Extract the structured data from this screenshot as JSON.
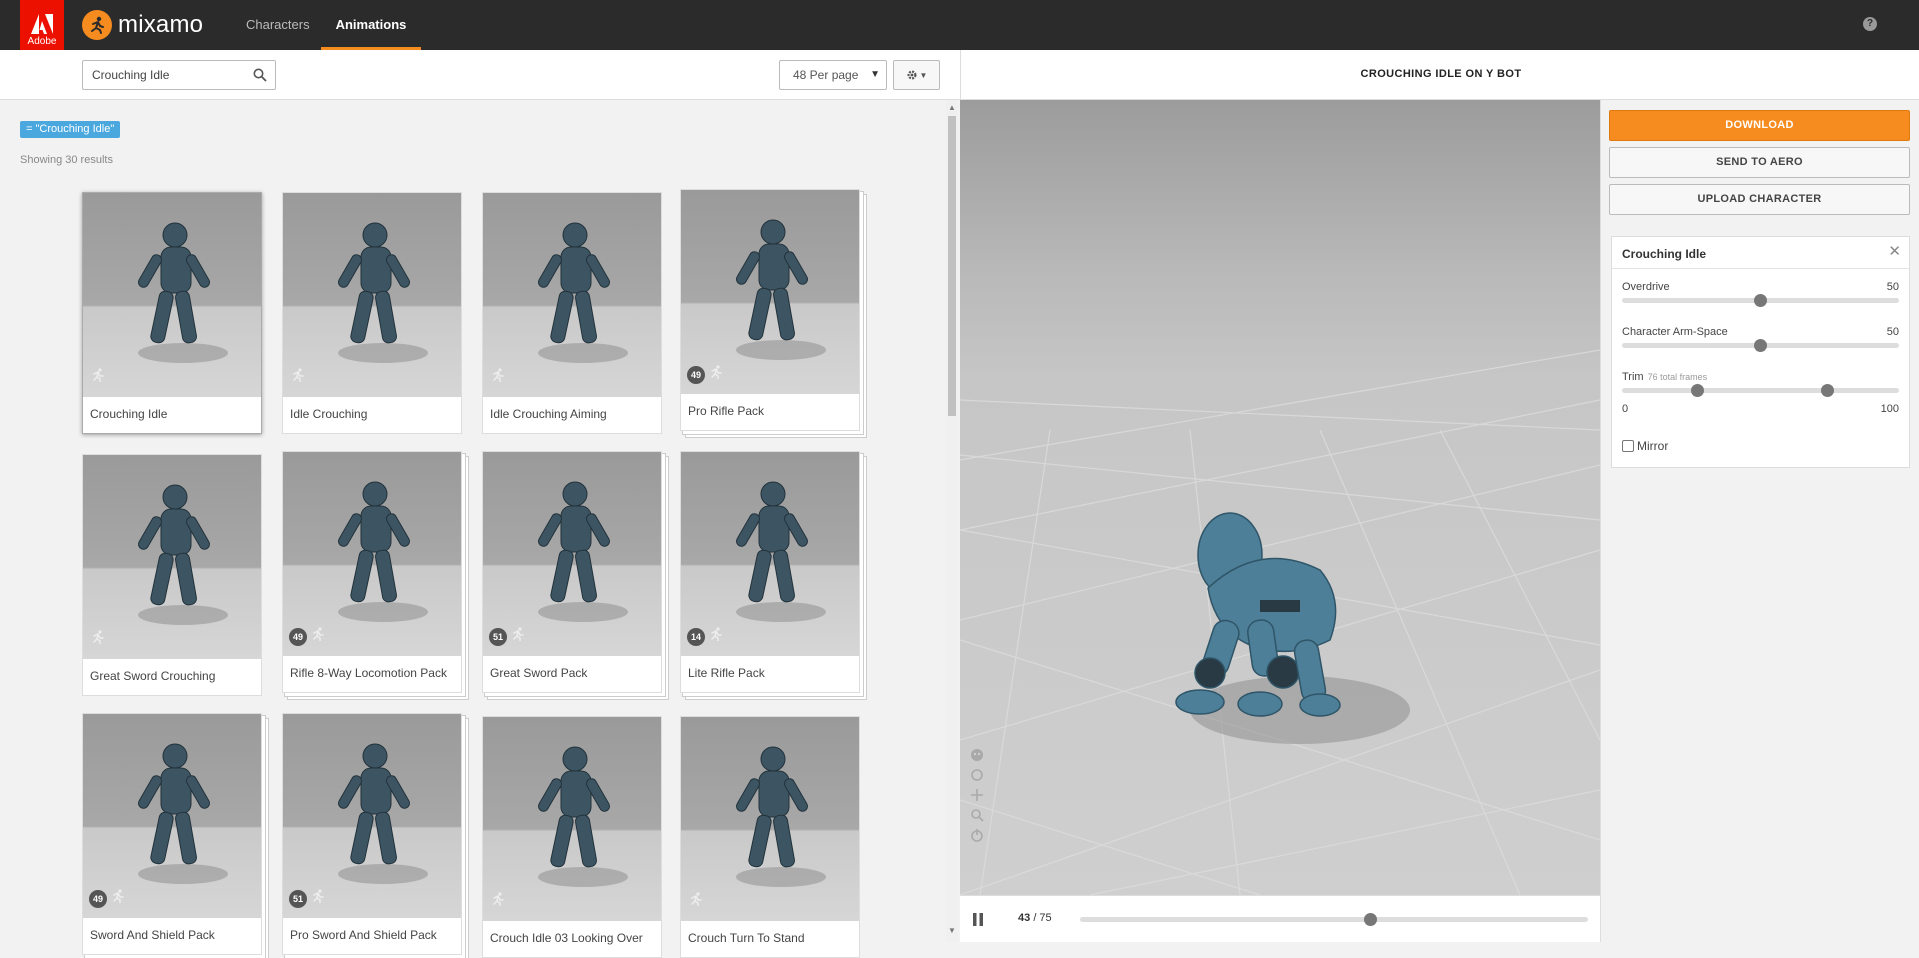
{
  "header": {
    "adobe_label": "Adobe",
    "brand": "mixamo",
    "nav": [
      {
        "label": "Characters",
        "active": false
      },
      {
        "label": "Animations",
        "active": true
      }
    ],
    "help_icon": "?"
  },
  "toolbar": {
    "search_value": "Crouching Idle",
    "per_page": "48 Per page",
    "settings_icon": "gear-icon"
  },
  "results": {
    "filter_chip": "= \"Crouching Idle\"",
    "count_text": "Showing 30 results"
  },
  "cards": [
    {
      "label": "Crouching Idle",
      "badge": "",
      "pack": false,
      "selected": true
    },
    {
      "label": "Idle Crouching",
      "badge": "",
      "pack": false,
      "selected": false
    },
    {
      "label": "Idle Crouching Aiming",
      "badge": "",
      "pack": false,
      "selected": false
    },
    {
      "label": "Pro Rifle Pack",
      "badge": "49",
      "pack": true,
      "selected": false
    },
    {
      "label": "Great Sword Crouching",
      "badge": "",
      "pack": false,
      "selected": false
    },
    {
      "label": "Rifle 8-Way Locomotion Pack",
      "badge": "49",
      "pack": true,
      "selected": false
    },
    {
      "label": "Great Sword Pack",
      "badge": "51",
      "pack": true,
      "selected": false
    },
    {
      "label": "Lite Rifle Pack",
      "badge": "14",
      "pack": true,
      "selected": false
    },
    {
      "label": "Sword And Shield Pack",
      "badge": "49",
      "pack": true,
      "selected": false
    },
    {
      "label": "Pro Sword And Shield Pack",
      "badge": "51",
      "pack": true,
      "selected": false
    },
    {
      "label": "Crouch Idle 03 Looking Over",
      "badge": "",
      "pack": false,
      "selected": false
    },
    {
      "label": "Crouch Turn To Stand",
      "badge": "",
      "pack": false,
      "selected": false
    }
  ],
  "viewer": {
    "title": "CROUCHING IDLE ON Y BOT",
    "frame_current": "43",
    "frame_total": "/ 75",
    "playhead_fraction": 0.57
  },
  "actions": {
    "download": "DOWNLOAD",
    "send_to_aero": "SEND TO AERO",
    "upload_character": "UPLOAD CHARACTER"
  },
  "settings": {
    "title": "Crouching Idle",
    "overdrive_label": "Overdrive",
    "overdrive_value": "50",
    "armspace_label": "Character Arm-Space",
    "armspace_value": "50",
    "trim_label": "Trim",
    "trim_note": "76 total frames",
    "trim_start_fraction": 0.27,
    "trim_end_fraction": 0.74,
    "trim_min": "0",
    "trim_max": "100",
    "mirror_label": "Mirror"
  }
}
